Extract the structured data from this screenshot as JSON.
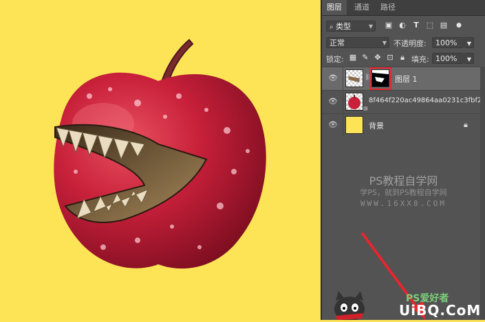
{
  "panel": {
    "tabs": [
      {
        "label": "图层"
      },
      {
        "label": "通道"
      },
      {
        "label": "路径"
      }
    ],
    "filter": {
      "kind_value": "类型"
    },
    "blend": {
      "mode_value": "正常",
      "opacity_label": "不透明度:",
      "opacity_value": "100%"
    },
    "lock": {
      "label": "锁定:",
      "fill_label": "填充:",
      "fill_value": "100%"
    },
    "layers": [
      {
        "name": "图层 1",
        "visible": true,
        "selected": true,
        "has_mask": true
      },
      {
        "name": "8f464f220ac49864aa0231c3fbf21...",
        "visible": true,
        "selected": false,
        "has_mask": false
      },
      {
        "name": "背景",
        "visible": true,
        "selected": false,
        "locked": true
      }
    ]
  },
  "watermark": {
    "title": "PS教程自学网",
    "subtitle": "学PS，就到PS教程自学网",
    "url": "WWW.16XX8.COM"
  },
  "footer": {
    "logo_text": "PS爱好者",
    "site": "UiBQ.CoM"
  },
  "colors": {
    "canvas_bg": "#fde457",
    "panel_bg": "#535353",
    "highlight": "#e6262d",
    "apple_red": "#c8203a"
  }
}
